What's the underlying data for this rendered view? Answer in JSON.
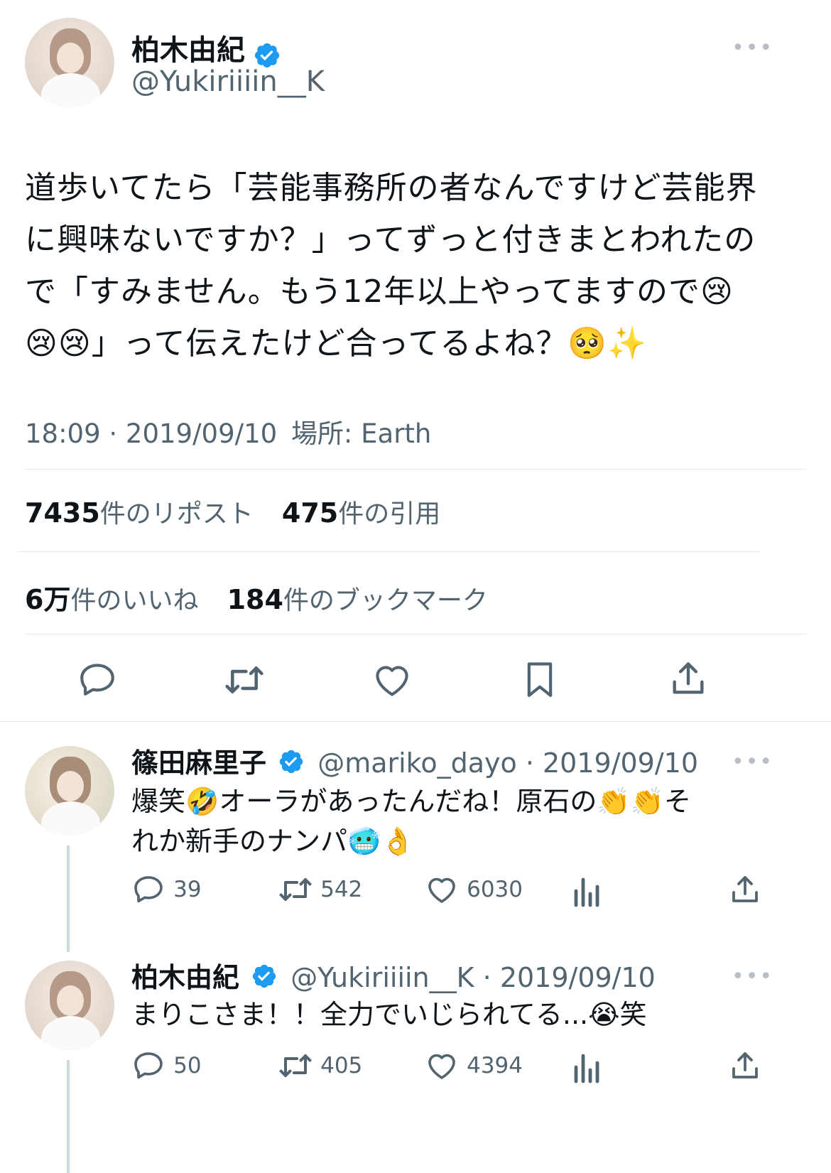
{
  "main_tweet": {
    "author_name": "柏木由紀",
    "author_handle": "@Yukiriiiin__K",
    "more": "•••",
    "text_lines": [
      "道歩いてたら「芸能事務所の者なんですけど芸能界",
      "に興味ないですか？」ってずっと付きまとわれたの",
      "で「すみません。もう12年以上やってますので😢",
      "😢😢」って伝えたけど合ってるよね？🥺✨"
    ],
    "timestamp": "18:09 · 2019/09/10",
    "location_label": "場所: Earth",
    "stats": {
      "reposts_num": "7435",
      "reposts_label": "件のリポスト",
      "quotes_num": "475",
      "quotes_label": "件の引用",
      "likes_num": "6万",
      "likes_label": "件のいいね",
      "bookmarks_num": "184",
      "bookmarks_label": "件のブックマーク"
    }
  },
  "replies": [
    {
      "author_name": "篠田麻里子",
      "author_handle": "@mariko_dayo",
      "date": "· 2019/09/10",
      "more": "•••",
      "text_lines": [
        "爆笑🤣オーラがあったんだね！原石の👏👏そ",
        "れか新手のナンパ🥶👌"
      ],
      "replies": "39",
      "reposts": "542",
      "likes": "6030"
    },
    {
      "author_name": "柏木由紀",
      "author_handle": "@Yukiriiiin__K",
      "date": "· 2019/09/10",
      "more": "•••",
      "text_lines": [
        "まりこさま！！全力でいじられてる...😭笑"
      ],
      "replies": "50",
      "reposts": "405",
      "likes": "4394"
    }
  ],
  "colors": {
    "verified": "#1d9bf0",
    "secondary_text": "#536471",
    "divider": "#e4e8eb",
    "thread_line": "#cfd9de"
  },
  "icons": [
    "verified-badge-icon",
    "reply-icon",
    "repost-icon",
    "like-icon",
    "bookmark-icon",
    "share-icon",
    "views-icon",
    "more-icon"
  ]
}
